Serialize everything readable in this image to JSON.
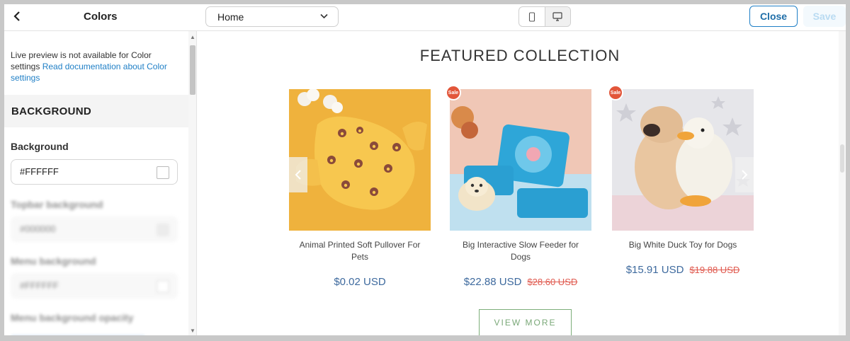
{
  "topbar": {
    "panel_title": "Colors",
    "page_select_value": "Home",
    "close_label": "Close",
    "save_label": "Save"
  },
  "left_panel": {
    "notice_text": "Live preview is not available for Color settings ",
    "notice_link": "Read documentation about Color settings",
    "section_title": "BACKGROUND",
    "fields": [
      {
        "label": "Background",
        "value": "#FFFFFF"
      },
      {
        "label": "Topbar background",
        "value": "#000000"
      },
      {
        "label": "Menu background",
        "value": "#FFFFFF"
      },
      {
        "label": "Menu background opacity",
        "value": ""
      }
    ]
  },
  "preview": {
    "title": "FEATURED COLLECTION",
    "sale_badge": "Sale",
    "products": [
      {
        "name": "Animal Printed Soft Pullover For Pets",
        "price": "$0.02 USD",
        "old_price": "",
        "sale": false
      },
      {
        "name": "Big Interactive Slow Feeder for Dogs",
        "price": "$22.88 USD",
        "old_price": "$28.60 USD",
        "sale": true
      },
      {
        "name": "Big White Duck Toy for Dogs",
        "price": "$15.91 USD",
        "old_price": "$19.88 USD",
        "sale": true
      }
    ],
    "view_more": "VIEW MORE"
  },
  "colors": {
    "accent": "#1f7fc6",
    "price": "#3e6a9e",
    "old_price": "#e05a4f",
    "button_green": "#7aa878"
  }
}
